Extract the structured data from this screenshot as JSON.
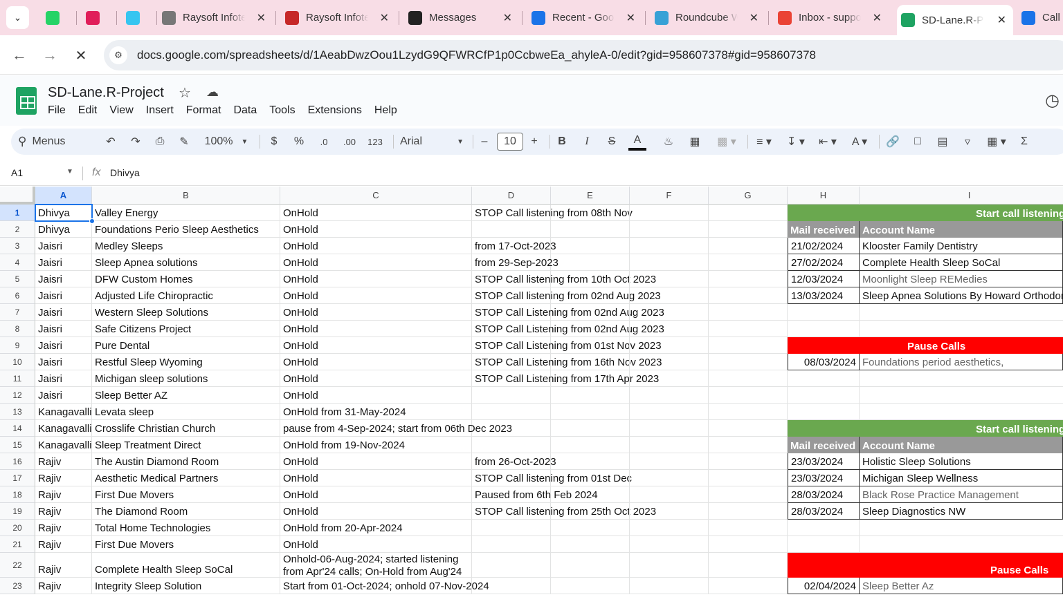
{
  "browser": {
    "tabs": [
      {
        "title": "",
        "icon": "whatsapp-icon",
        "color": "#25d366"
      },
      {
        "title": "",
        "icon": "slack-icon",
        "color": "#e01e5a"
      },
      {
        "title": "",
        "icon": "slack-icon",
        "color": "#36c5f0"
      },
      {
        "title": "Raysoft Infote",
        "icon": "globe-icon",
        "color": "#777777"
      },
      {
        "title": "Raysoft Infote",
        "icon": "graduation-cap-icon",
        "color": "#c62828"
      },
      {
        "title": "Messages",
        "icon": "upwork-icon",
        "color": "#222222"
      },
      {
        "title": "Recent - Goo",
        "icon": "google-drive-icon",
        "color": "#1a73e8"
      },
      {
        "title": "Roundcube W",
        "icon": "roundcube-icon",
        "color": "#37a1d6"
      },
      {
        "title": "Inbox - suppo",
        "icon": "gmail-icon",
        "color": "#ea4335"
      },
      {
        "title": "SD-Lane.R-Pr",
        "icon": "sheets-loading-icon",
        "color": "#1ea362"
      },
      {
        "title": "Call",
        "icon": "phone-icon",
        "color": "#1a73e8"
      }
    ],
    "url": "docs.google.com/spreadsheets/d/1AeabDwzOou1LzydG9QFWRCfP1p0CcbweEa_ahyleA-0/edit?gid=958607378#gid=958607378"
  },
  "sheets": {
    "title": "SD-Lane.R-Project",
    "menu": [
      "File",
      "Edit",
      "View",
      "Insert",
      "Format",
      "Data",
      "Tools",
      "Extensions",
      "Help"
    ],
    "toolbar": {
      "search_label": "Menus",
      "zoom": "100%",
      "currency": "$",
      "percent": "%",
      "dec_decrease": ".0",
      "dec_increase": ".00",
      "number_format": "123",
      "font": "Arial",
      "font_size": "10"
    },
    "name_box": "A1",
    "formula": "Dhivya"
  },
  "grid": {
    "columns": [
      "A",
      "B",
      "C",
      "D",
      "E",
      "F",
      "G",
      "H",
      "I"
    ],
    "rows": [
      {
        "n": "1",
        "a": "Dhivya",
        "b": "Valley Energy",
        "c": "OnHold",
        "d": "STOP Call listening from 08th Nov"
      },
      {
        "n": "2",
        "a": "Dhivya",
        "b": "Foundations Perio Sleep Aesthetics",
        "c": "OnHold",
        "d": ""
      },
      {
        "n": "3",
        "a": "Jaisri",
        "b": "Medley Sleeps",
        "c": "OnHold",
        "d": "from 17-Oct-2023"
      },
      {
        "n": "4",
        "a": "Jaisri",
        "b": "Sleep Apnea solutions",
        "c": "OnHold",
        "d": "from 29-Sep-2023"
      },
      {
        "n": "5",
        "a": "Jaisri",
        "b": "DFW Custom Homes",
        "c": "OnHold",
        "d": "STOP Call listening from 10th Oct 2023"
      },
      {
        "n": "6",
        "a": "Jaisri",
        "b": "Adjusted Life Chiropractic",
        "c": "OnHold",
        "d": "STOP Call listening from 02nd Aug 2023"
      },
      {
        "n": "7",
        "a": "Jaisri",
        "b": "Western Sleep Solutions",
        "c": "OnHold",
        "d": "STOP Call Listening from 02nd Aug 2023"
      },
      {
        "n": "8",
        "a": "Jaisri",
        "b": "Safe Citizens Project",
        "c": "OnHold",
        "d": "STOP Call Listening from 02nd Aug 2023"
      },
      {
        "n": "9",
        "a": "Jaisri",
        "b": "Pure Dental",
        "c": "OnHold",
        "d": "STOP Call Listening from 01st Nov 2023"
      },
      {
        "n": "10",
        "a": "Jaisri",
        "b": "Restful Sleep Wyoming",
        "c": "OnHold",
        "d": "STOP Call Listening from 16th Nov 2023"
      },
      {
        "n": "11",
        "a": "Jaisri",
        "b": "Michigan sleep solutions",
        "c": "OnHold",
        "d": "STOP Call Listening from 17th Apr 2023"
      },
      {
        "n": "12",
        "a": "Jaisri",
        "b": "Sleep Better AZ",
        "c": "OnHold",
        "d": ""
      },
      {
        "n": "13",
        "a": "Kanagavalli",
        "b": "Levata sleep",
        "c": "OnHold from 31-May-2024",
        "d": ""
      },
      {
        "n": "14",
        "a": "Kanagavalli",
        "b": "Crosslife Christian Church",
        "c": "pause from 4-Sep-2024; start from 06th Dec 2023",
        "d": ""
      },
      {
        "n": "15",
        "a": "Kanagavalli",
        "b": "Sleep Treatment Direct",
        "c": "OnHold from 19-Nov-2024",
        "d": ""
      },
      {
        "n": "16",
        "a": "Rajiv",
        "b": "The Austin Diamond Room",
        "c": "OnHold",
        "d": "from 26-Oct-2023"
      },
      {
        "n": "17",
        "a": "Rajiv",
        "b": "Aesthetic Medical Partners",
        "c": "OnHold",
        "d": "STOP Call listening from 01st Dec"
      },
      {
        "n": "18",
        "a": "Rajiv",
        "b": "First Due Movers",
        "c": "OnHold",
        "d": "Paused from 6th Feb 2024"
      },
      {
        "n": "19",
        "a": "Rajiv",
        "b": "The Diamond Room",
        "c": "OnHold",
        "d": "STOP Call listening from 25th Oct 2023"
      },
      {
        "n": "20",
        "a": "Rajiv",
        "b": "Total Home Technologies",
        "c": "OnHold from 20-Apr-2024",
        "d": ""
      },
      {
        "n": "21",
        "a": "Rajiv",
        "b": "First Due Movers",
        "c": "OnHold",
        "d": ""
      },
      {
        "n": "22",
        "a": "Rajiv",
        "b": "Complete Health Sleep SoCal",
        "c": "Onhold-06-Aug-2024; started listening from Apr'24 calls; On-Hold from Aug'24",
        "d": ""
      },
      {
        "n": "23",
        "a": "Rajiv",
        "b": "Integrity Sleep Solution",
        "c": "Start from 01-Oct-2024; onhold 07-Nov-2024",
        "d": ""
      }
    ]
  },
  "panel": {
    "start_label": "Start call listening",
    "pause_label": "Pause Calls",
    "hdr_mail": "Mail received",
    "hdr_account": "Account Name",
    "block1": [
      {
        "date": "21/02/2024",
        "name": "Klooster Family Dentistry",
        "gray": false
      },
      {
        "date": "27/02/2024",
        "name": "Complete Health Sleep SoCal",
        "gray": false
      },
      {
        "date": "12/03/2024",
        "name": "Moonlight Sleep REMedies",
        "gray": true
      },
      {
        "date": "13/03/2024",
        "name": "Sleep Apnea Solutions By Howard Orthodon",
        "gray": false
      }
    ],
    "pause1": {
      "date": "08/03/2024",
      "name": "Foundations period aesthetics,"
    },
    "block2": [
      {
        "date": "23/03/2024",
        "name": "Holistic Sleep Solutions",
        "gray": false
      },
      {
        "date": "23/03/2024",
        "name": "Michigan Sleep Wellness",
        "gray": false
      },
      {
        "date": "28/03/2024",
        "name": "Black Rose Practice Management",
        "gray": true
      },
      {
        "date": "28/03/2024",
        "name": "Sleep Diagnostics NW",
        "gray": false
      }
    ],
    "pause2": {
      "date": "02/04/2024",
      "name": "Sleep Better Az"
    }
  },
  "colors": {
    "green_band": "#6aa84f",
    "red_band": "#ff0000",
    "header_gray": "#999999",
    "selection": "#1a73e8"
  }
}
